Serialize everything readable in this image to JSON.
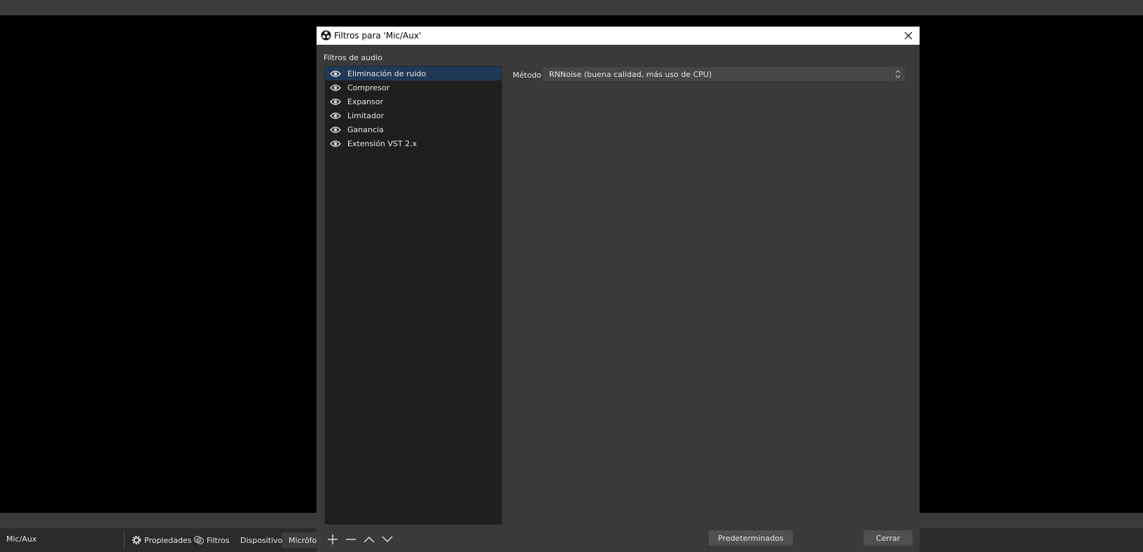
{
  "main_window": {
    "source_name": "Mic/Aux",
    "properties_label": "Propiedades",
    "filters_label": "Filtros",
    "device_label": "Dispositivo",
    "device_value": "Micrófono"
  },
  "dialog": {
    "title": "Filtros para 'Mic/Aux'",
    "section_label": "Filtros de audio",
    "filters": [
      {
        "label": "Eliminación de ruido",
        "selected": true
      },
      {
        "label": "Compresor",
        "selected": false
      },
      {
        "label": "Expansor",
        "selected": false
      },
      {
        "label": "Limitador",
        "selected": false
      },
      {
        "label": "Ganancia",
        "selected": false
      },
      {
        "label": "Extensión VST 2.x",
        "selected": false
      }
    ],
    "method_label": "Método",
    "method_value": "RNNoise (buena calidad, más uso de CPU)",
    "defaults_button": "Predeterminados",
    "close_button": "Cerrar"
  },
  "colors": {
    "selection": "#1f3a56",
    "dialog_bg": "#3a3a3a",
    "list_bg": "#1f1f1f"
  }
}
